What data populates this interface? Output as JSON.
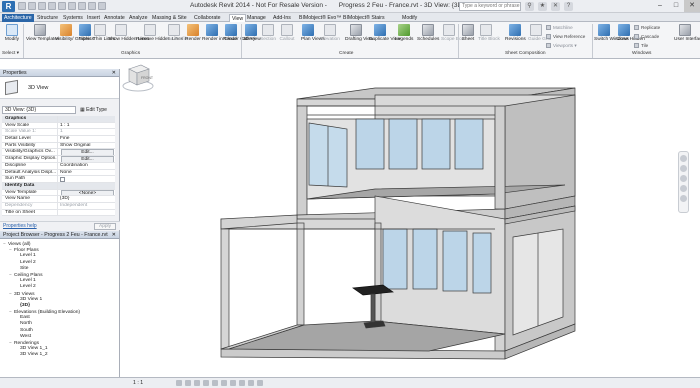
{
  "titlebar": {
    "app_logo": "R",
    "app_title": "Autodesk Revit 2014 -",
    "license": "Not For Resale Version -",
    "document_title": "Progress 2 Feu - France.rvt - 3D View: {3D}",
    "search_placeholder": "Type a keyword or phrase"
  },
  "tabs": [
    "Architecture",
    "Structure",
    "Systems",
    "Insert",
    "Annotate",
    "Analyze",
    "Massing & Site",
    "Collaborate",
    "View",
    "Manage",
    "Add-Ins",
    "BIMobject® Evo™",
    "BIMobject® Stairs",
    "Modify"
  ],
  "active_tab": "View",
  "ribbon": {
    "buttons": [
      "Modify",
      "View Templates",
      "Visibility/ Graphics",
      "Filters",
      "Thin Lines",
      "Show Hidden Lines",
      "Remove Hidden Lines",
      "Cut Profile",
      "Render",
      "Render in Cloud",
      "Render Gallery",
      "3D View",
      "Section",
      "Callout",
      "Plan Views",
      "Elevation",
      "Drafting View",
      "Duplicate View",
      "Legends",
      "Schedules",
      "Scope Box",
      "Sheet",
      "Title Block",
      "Revisions",
      "Guide Grid",
      "Matchline",
      "View Reference",
      "Viewports",
      "Switch Windows",
      "Close Hidden",
      "Replicate",
      "Cascade",
      "Tile",
      "User Interface"
    ],
    "select_label": "Select ▾",
    "panels": [
      "Graphics",
      "Create",
      "Sheet Composition",
      "Windows"
    ]
  },
  "properties": {
    "title": "Properties",
    "type_name": "3D View",
    "selector_value": "3D View: {3D}",
    "edit_type": "Edit Type",
    "rows": [
      {
        "k": "Graphics",
        "v": "",
        "group": true
      },
      {
        "k": "View Scale",
        "v": "1 : 1"
      },
      {
        "k": "Scale Value    1:",
        "v": "1",
        "dim": true
      },
      {
        "k": "Detail Level",
        "v": "Fine"
      },
      {
        "k": "Parts Visibility",
        "v": "Show Original"
      },
      {
        "k": "Visibility/Graphics Ov...",
        "v": "Edit...",
        "btn": true
      },
      {
        "k": "Graphic Display Option...",
        "v": "Edit...",
        "btn": true
      },
      {
        "k": "Discipline",
        "v": "Coordination"
      },
      {
        "k": "Default Analysis Displ...",
        "v": "None"
      },
      {
        "k": "Sun Path",
        "v": "",
        "check": true
      },
      {
        "k": "Identity Data",
        "v": "",
        "group": true
      },
      {
        "k": "View Template",
        "v": "<None>",
        "btn": true
      },
      {
        "k": "View Name",
        "v": "{3D}"
      },
      {
        "k": "Dependency",
        "v": "Independent",
        "dim": true
      },
      {
        "k": "Title on Sheet",
        "v": ""
      }
    ],
    "help_link": "Properties help",
    "apply": "Apply"
  },
  "browser": {
    "title": "Project Browser - Progress 2 Feu - France.rvt",
    "tree": [
      {
        "indent": 0,
        "toggle": "−",
        "label": "Views (all)"
      },
      {
        "indent": 1,
        "toggle": "−",
        "label": "Floor Plans"
      },
      {
        "indent": 2,
        "toggle": "",
        "label": "Level 1"
      },
      {
        "indent": 2,
        "toggle": "",
        "label": "Level 2"
      },
      {
        "indent": 2,
        "toggle": "",
        "label": "Site"
      },
      {
        "indent": 1,
        "toggle": "−",
        "label": "Ceiling Plans"
      },
      {
        "indent": 2,
        "toggle": "",
        "label": "Level 1"
      },
      {
        "indent": 2,
        "toggle": "",
        "label": "Level 2"
      },
      {
        "indent": 1,
        "toggle": "−",
        "label": "3D Views"
      },
      {
        "indent": 2,
        "toggle": "",
        "label": "3D View 1"
      },
      {
        "indent": 2,
        "toggle": "",
        "label": "{3D}",
        "bold": true
      },
      {
        "indent": 1,
        "toggle": "−",
        "label": "Elevations (Building Elevation)"
      },
      {
        "indent": 2,
        "toggle": "",
        "label": "East"
      },
      {
        "indent": 2,
        "toggle": "",
        "label": "North"
      },
      {
        "indent": 2,
        "toggle": "",
        "label": "South"
      },
      {
        "indent": 2,
        "toggle": "",
        "label": "West"
      },
      {
        "indent": 1,
        "toggle": "−",
        "label": "Renderings"
      },
      {
        "indent": 2,
        "toggle": "",
        "label": "3D View 1_1"
      },
      {
        "indent": 2,
        "toggle": "",
        "label": "3D View 1_2"
      }
    ]
  },
  "viewport": {
    "scale": "1 : 1",
    "viewcube_label": "FRONT"
  }
}
